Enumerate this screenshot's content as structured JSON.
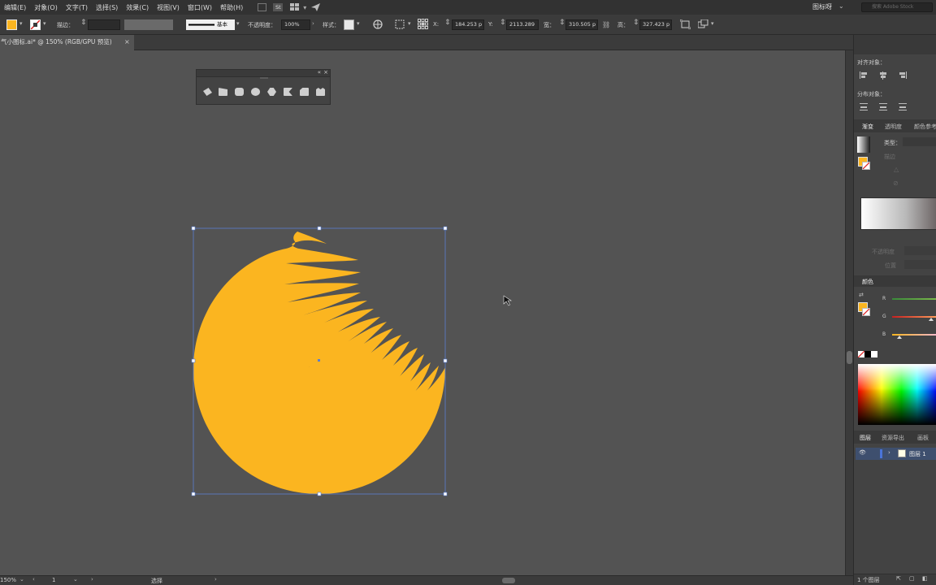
{
  "menubar": {
    "items": [
      "编辑(E)",
      "对象(O)",
      "文字(T)",
      "选择(S)",
      "效果(C)",
      "视图(V)",
      "窗口(W)",
      "帮助(H)"
    ],
    "st_label": "St",
    "workspace": "图标呀",
    "search_placeholder": "搜索 Adobe Stock"
  },
  "control": {
    "stroke_label": "描边：",
    "stroke_style": "基本",
    "opacity_label": "不透明度：",
    "opacity_value": "100%",
    "style_label": "样式：",
    "x_label": "X:",
    "x_value": "184.253 p",
    "y_label": "Y:",
    "y_value": "2113.289",
    "w_label": "宽：",
    "w_value": "310.505 p",
    "h_label": "高：",
    "h_value": "327.423 p",
    "colors": {
      "fill": "#fbb520",
      "accent": "#4a74d8"
    }
  },
  "document": {
    "tab_title": "气小图标.ai* @ 150% (RGB/GPU 预览)",
    "close_glyph": "×"
  },
  "artwork": {
    "fill_color": "#fbb520",
    "selection_color": "#5b7fd1"
  },
  "status": {
    "zoom": "150%",
    "artboard": "1",
    "tool": "选择"
  },
  "panel": {
    "align_objects": "对齐对象：",
    "distribute_objects": "分布对象：",
    "tabs_gradient": [
      "渐变",
      "透明度",
      "颜色参考"
    ],
    "gradient_type_label": "类型：",
    "gradient_stroke_label": "描边",
    "gradient_opacity_label": "不透明度",
    "gradient_position_label": "位置",
    "color_title": "颜色",
    "color_channels": [
      "R",
      "G",
      "B"
    ],
    "tabs_layers": [
      "图层",
      "资源导出",
      "画板"
    ],
    "layer_name": "图层 1",
    "layer_count": "1 个图层"
  }
}
